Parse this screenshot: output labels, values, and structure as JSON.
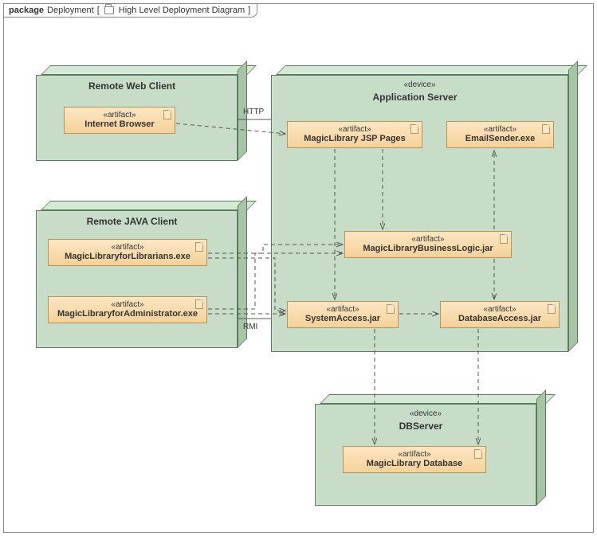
{
  "package": {
    "keyword": "package",
    "name": "Deployment",
    "diagramTitle": "High Level Deployment Diagram"
  },
  "nodes": {
    "webClient": {
      "title": "Remote Web Client"
    },
    "javaClient": {
      "title": "Remote JAVA Client"
    },
    "appServer": {
      "stereotype": "«device»",
      "title": "Application Server"
    },
    "dbServer": {
      "stereotype": "«device»",
      "title": "DBServer"
    }
  },
  "artifacts": {
    "browser": {
      "stereotype": "«artifact»",
      "name": "Internet Browser"
    },
    "librarians": {
      "stereotype": "«artifact»",
      "name": "MagicLibraryforLibrarians.exe"
    },
    "admin": {
      "stereotype": "«artifact»",
      "name": "MagicLibraryforAdministrator.exe"
    },
    "jsp": {
      "stereotype": "«artifact»",
      "name": "MagicLibrary JSP Pages"
    },
    "email": {
      "stereotype": "«artifact»",
      "name": "EmailSender.exe"
    },
    "biz": {
      "stereotype": "«artifact»",
      "name": "MagicLibraryBusinessLogic.jar"
    },
    "sys": {
      "stereotype": "«artifact»",
      "name": "SystemAccess.jar"
    },
    "dba": {
      "stereotype": "«artifact»",
      "name": "DatabaseAccess.jar"
    },
    "db": {
      "stereotype": "«artifact»",
      "name": "MagicLibrary Database"
    }
  },
  "labels": {
    "http": "HTTP",
    "rmi": "RMI"
  }
}
